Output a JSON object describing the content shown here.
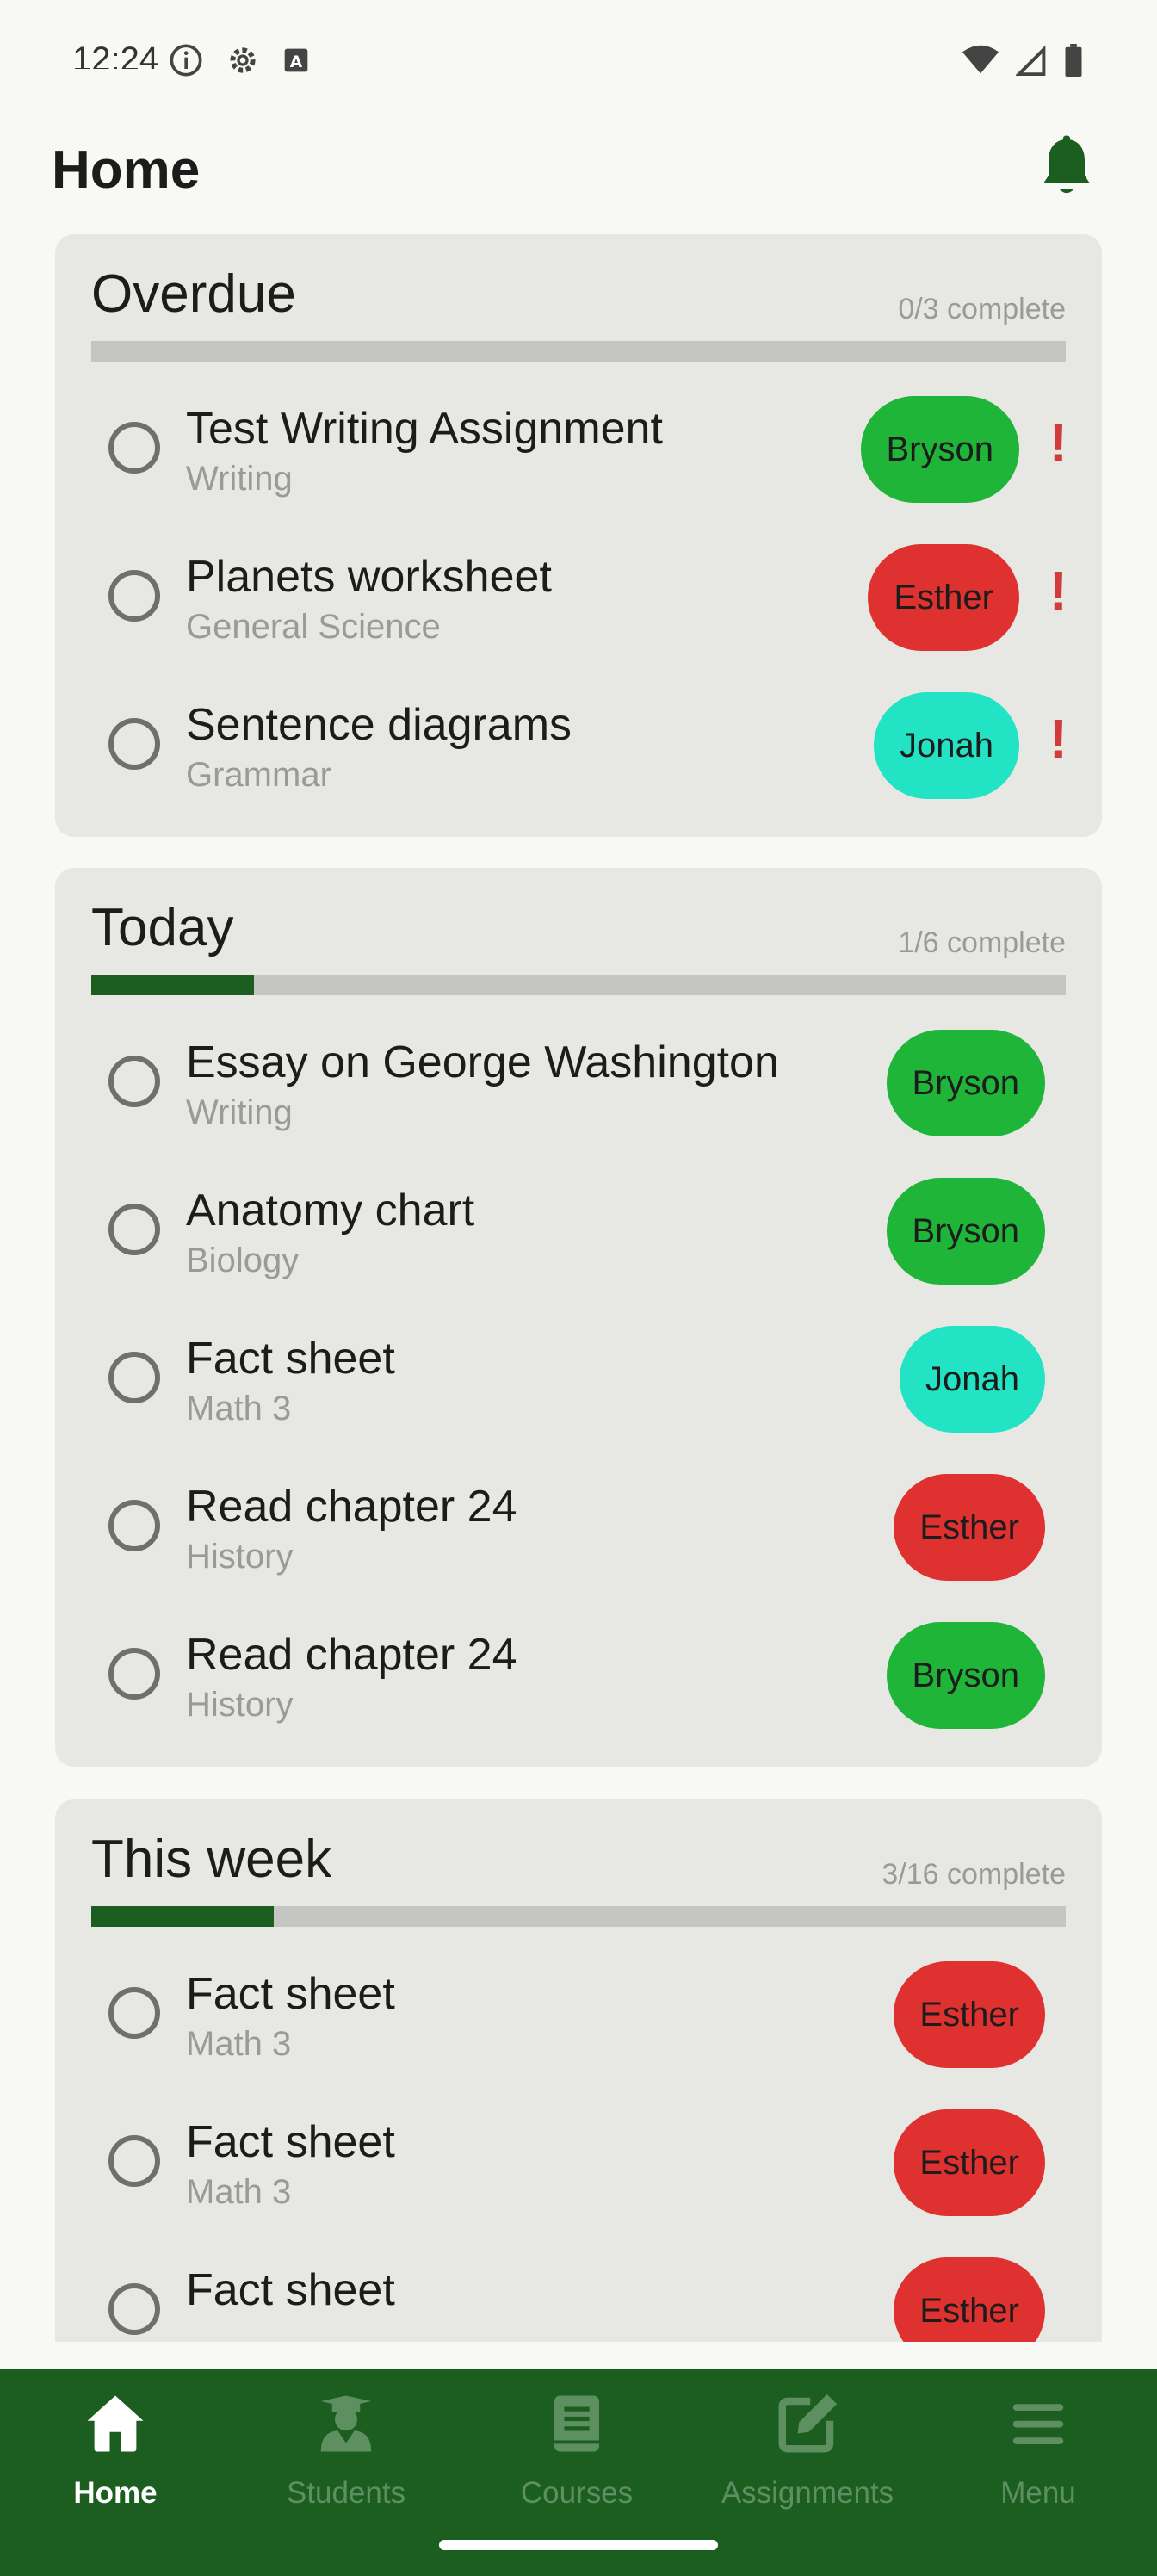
{
  "status_bar": {
    "time": "12:24"
  },
  "header": {
    "title": "Home"
  },
  "colors": {
    "brand_green": "#1b5e20",
    "pill_green": "#1eb538",
    "pill_red": "#e03131",
    "pill_teal": "#22e3c3",
    "alert_red": "#d23b3b"
  },
  "sections": [
    {
      "title": "Overdue",
      "progress_text": "0/3 complete",
      "progress": 0.0,
      "tasks": [
        {
          "title": "Test Writing Assignment",
          "subject": "Writing",
          "student": "Bryson",
          "student_color": "#1eb538",
          "overdue": true,
          "alert": "!"
        },
        {
          "title": "Planets worksheet",
          "subject": "General Science",
          "student": "Esther",
          "student_color": "#e03131",
          "overdue": true,
          "alert": "!"
        },
        {
          "title": "Sentence diagrams",
          "subject": "Grammar",
          "student": "Jonah",
          "student_color": "#22e3c3",
          "overdue": true,
          "alert": "!"
        }
      ]
    },
    {
      "title": "Today",
      "progress_text": "1/6 complete",
      "progress": 0.1667,
      "tasks": [
        {
          "title": "Essay on George Washington",
          "subject": "Writing",
          "student": "Bryson",
          "student_color": "#1eb538"
        },
        {
          "title": "Anatomy chart",
          "subject": "Biology",
          "student": "Bryson",
          "student_color": "#1eb538"
        },
        {
          "title": "Fact sheet",
          "subject": "Math 3",
          "student": "Jonah",
          "student_color": "#22e3c3"
        },
        {
          "title": "Read chapter 24",
          "subject": "History",
          "student": "Esther",
          "student_color": "#e03131"
        },
        {
          "title": "Read chapter 24",
          "subject": "History",
          "student": "Bryson",
          "student_color": "#1eb538"
        }
      ]
    },
    {
      "title": "This week",
      "progress_text": "3/16 complete",
      "progress": 0.1875,
      "tasks": [
        {
          "title": "Fact sheet",
          "subject": "Math 3",
          "student": "Esther",
          "student_color": "#e03131"
        },
        {
          "title": "Fact sheet",
          "subject": "Math 3",
          "student": "Esther",
          "student_color": "#e03131"
        },
        {
          "title": "Fact sheet",
          "subject": "",
          "student": "Esther",
          "student_color": "#e03131"
        }
      ]
    }
  ],
  "bottom_nav": {
    "items": [
      {
        "label": "Home",
        "icon": "home-icon",
        "active": true
      },
      {
        "label": "Students",
        "icon": "student-icon",
        "active": false
      },
      {
        "label": "Courses",
        "icon": "book-icon",
        "active": false
      },
      {
        "label": "Assignments",
        "icon": "edit-icon",
        "active": false
      },
      {
        "label": "Menu",
        "icon": "menu-icon",
        "active": false
      }
    ]
  }
}
